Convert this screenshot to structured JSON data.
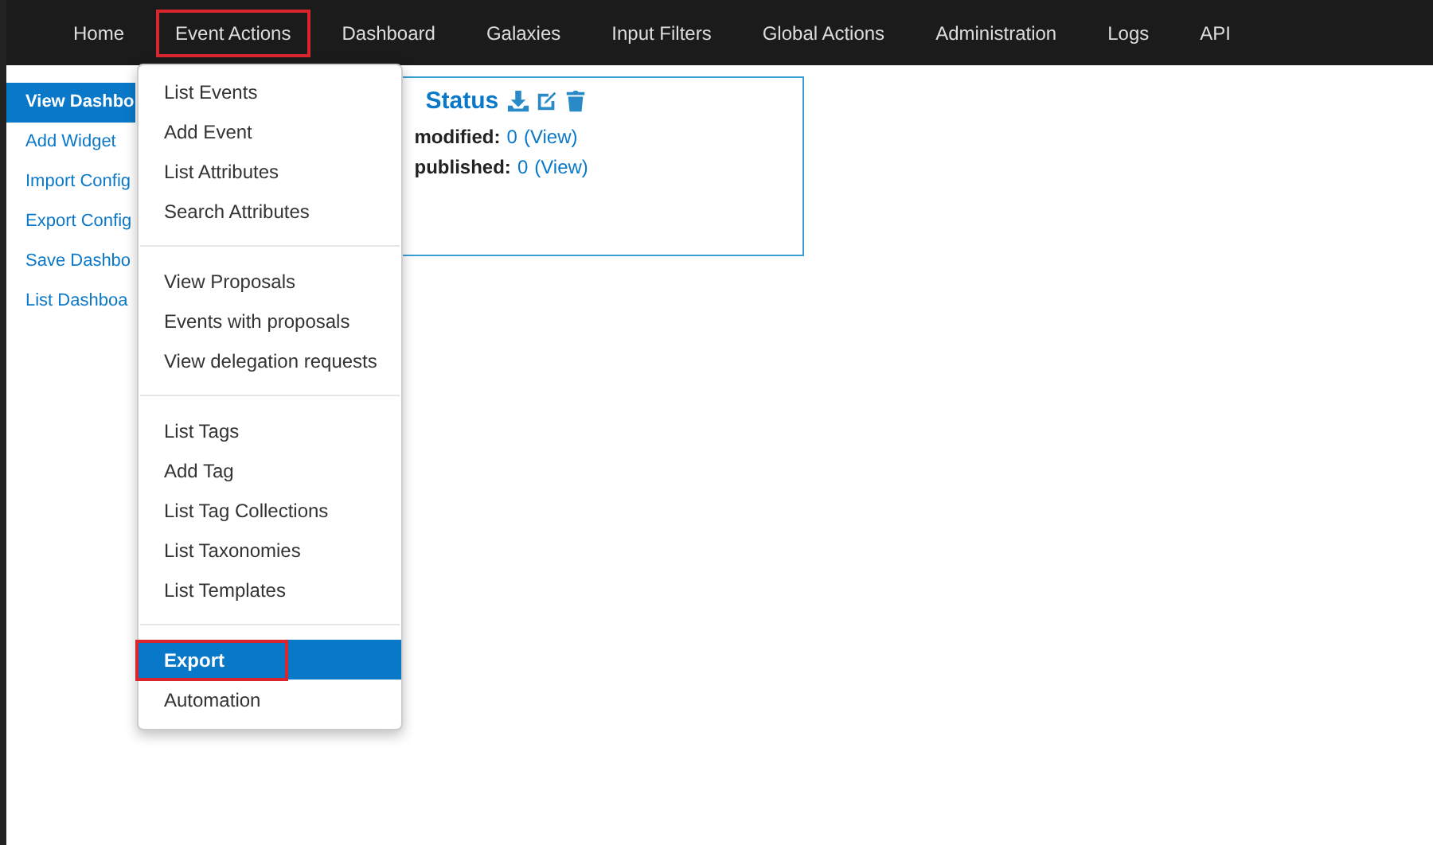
{
  "navbar": {
    "items": [
      {
        "label": "Home",
        "highlighted": false
      },
      {
        "label": "Event Actions",
        "highlighted": true
      },
      {
        "label": "Dashboard",
        "highlighted": false
      },
      {
        "label": "Galaxies",
        "highlighted": false
      },
      {
        "label": "Input Filters",
        "highlighted": false
      },
      {
        "label": "Global Actions",
        "highlighted": false
      },
      {
        "label": "Administration",
        "highlighted": false
      },
      {
        "label": "Logs",
        "highlighted": false
      },
      {
        "label": "API",
        "highlighted": false
      }
    ]
  },
  "sidebar": {
    "items": [
      {
        "label": "View Dashbo",
        "selected": true
      },
      {
        "label": "Add Widget",
        "selected": false
      },
      {
        "label": "Import Config",
        "selected": false
      },
      {
        "label": "Export Config",
        "selected": false
      },
      {
        "label": "Save Dashbo",
        "selected": false
      },
      {
        "label": "List Dashboa",
        "selected": false
      }
    ]
  },
  "widget": {
    "title": "Status",
    "rows": [
      {
        "label": "modified:",
        "value": "0",
        "link": "(View)"
      },
      {
        "label": "published:",
        "value": "0",
        "link": "(View)"
      }
    ]
  },
  "menu": {
    "groups": [
      [
        {
          "label": "List Events",
          "selected": false,
          "highlighted": false
        },
        {
          "label": "Add Event",
          "selected": false,
          "highlighted": false
        },
        {
          "label": "List Attributes",
          "selected": false,
          "highlighted": false
        },
        {
          "label": "Search Attributes",
          "selected": false,
          "highlighted": false
        }
      ],
      [
        {
          "label": "View Proposals",
          "selected": false,
          "highlighted": false
        },
        {
          "label": "Events with proposals",
          "selected": false,
          "highlighted": false
        },
        {
          "label": "View delegation requests",
          "selected": false,
          "highlighted": false
        }
      ],
      [
        {
          "label": "List Tags",
          "selected": false,
          "highlighted": false
        },
        {
          "label": "Add Tag",
          "selected": false,
          "highlighted": false
        },
        {
          "label": "List Tag Collections",
          "selected": false,
          "highlighted": false
        },
        {
          "label": "List Taxonomies",
          "selected": false,
          "highlighted": false
        },
        {
          "label": "List Templates",
          "selected": false,
          "highlighted": false
        }
      ],
      [
        {
          "label": "Export",
          "selected": true,
          "highlighted": true
        },
        {
          "label": "Automation",
          "selected": false,
          "highlighted": false
        }
      ]
    ]
  }
}
